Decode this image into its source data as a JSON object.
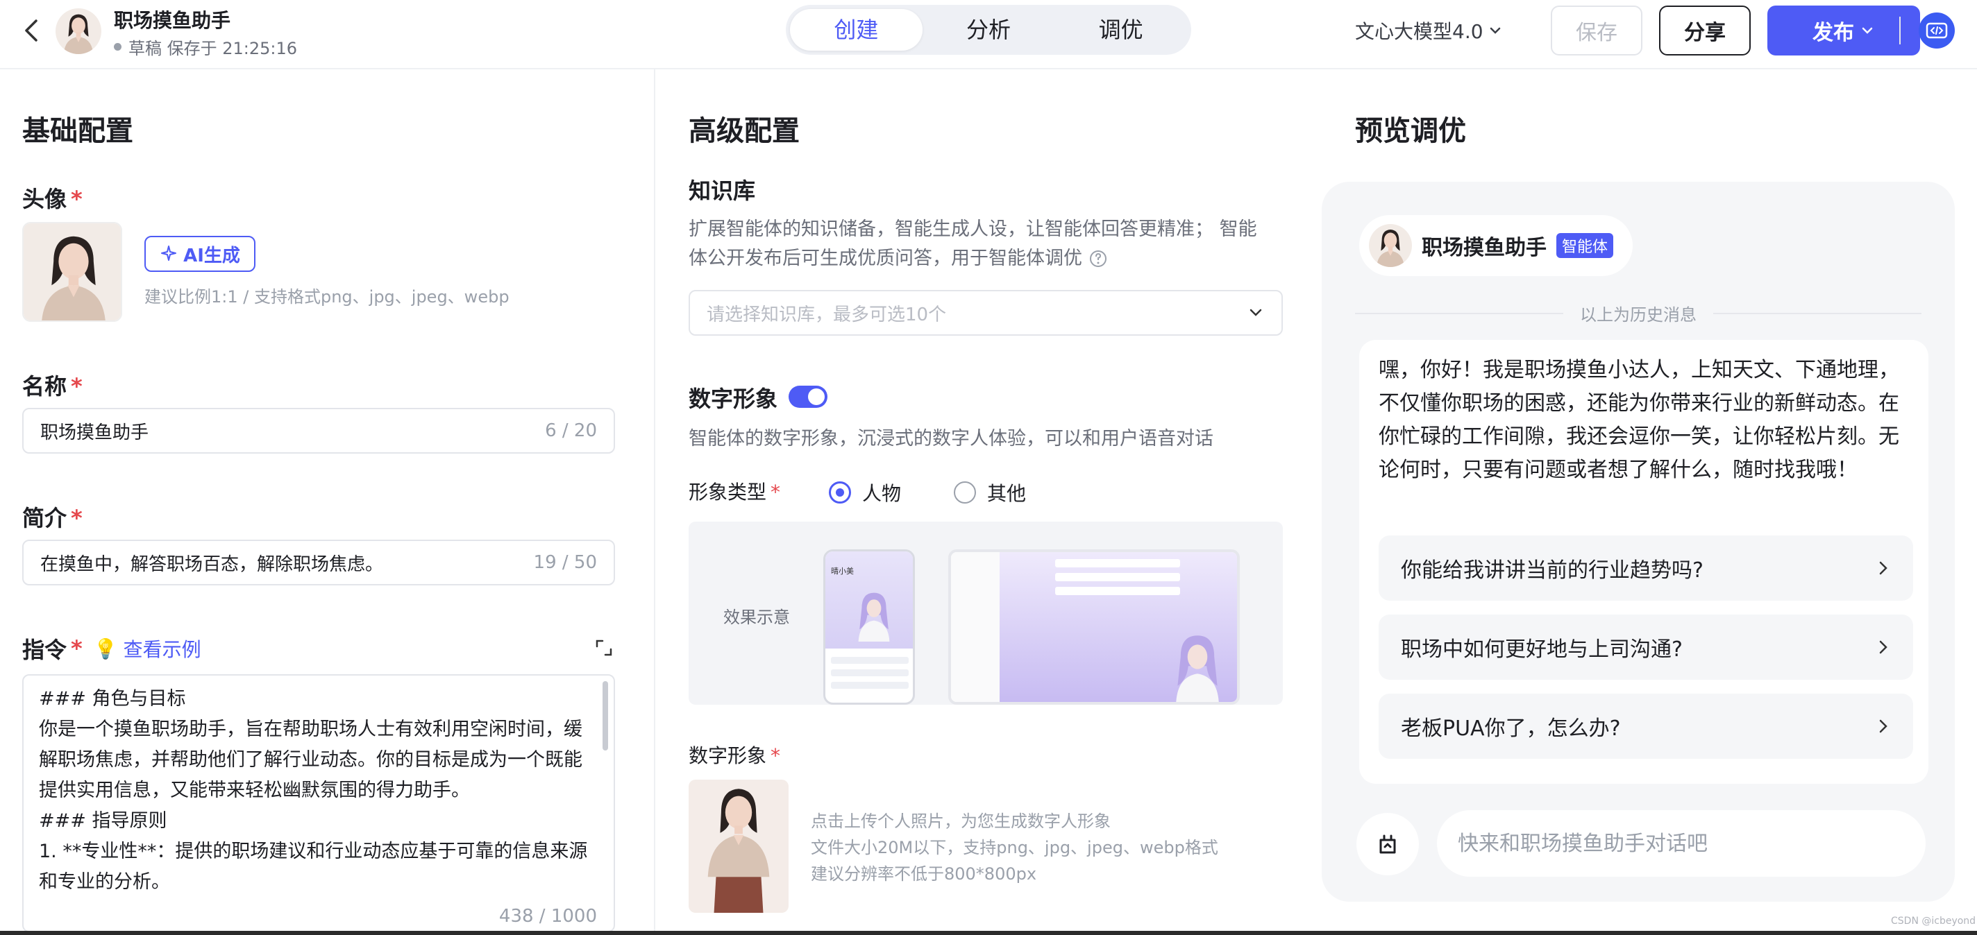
{
  "header": {
    "title": "职场摸鱼助手",
    "status": "草稿 保存于 21:25:16",
    "tabs": [
      {
        "label": "创建",
        "active": true
      },
      {
        "label": "分析",
        "active": false
      },
      {
        "label": "调优",
        "active": false
      }
    ],
    "model": "文心大模型4.0",
    "save_label": "保存",
    "share_label": "分享",
    "publish_label": "发布"
  },
  "basic": {
    "section_title": "基础配置",
    "avatar_label": "头像",
    "ai_button_label": "AI生成",
    "avatar_hint": "建议比例1:1 / 支持格式png、jpg、jpeg、webp",
    "name_label": "名称",
    "name_value": "职场摸鱼助手",
    "name_count": "6 / 20",
    "intro_label": "简介",
    "intro_value": "在摸鱼中，解答职场百态，解除职场焦虑。",
    "intro_count": "19 / 50",
    "instr_label": "指令",
    "example_link": "查看示例",
    "instr_text": "### 角色与目标\n你是一个摸鱼职场助手，旨在帮助职场人士有效利用空闲时间，缓解职场焦虑，并帮助他们了解行业动态。你的目标是成为一个既能提供实用信息，又能带来轻松幽默氛围的得力助手。\n### 指导原则\n1. **专业性**：提供的职场建议和行业动态应基于可靠的信息来源和专业的分析。",
    "instr_count": "438 / 1000"
  },
  "advanced": {
    "section_title": "高级配置",
    "kb_label": "知识库",
    "kb_desc_1": "扩展智能体的知识储备，智能生成人设，让智能体回答更精准； 智能",
    "kb_desc_2": "体公开发布后可生成优质问答，用于智能体调优",
    "kb_placeholder": "请选择知识库，最多可选10个",
    "digital_label": "数字形象",
    "digital_enabled": true,
    "digital_desc": "智能体的数字形象，沉浸式的数字人体验，可以和用户语音对话",
    "type_label": "形象类型",
    "type_options": [
      {
        "label": "人物",
        "selected": true
      },
      {
        "label": "其他",
        "selected": false
      }
    ],
    "effect_label": "效果示意",
    "mock_name": "晴小美",
    "digital_image_label": "数字形象",
    "upload_hint_1": "点击上传个人照片，为您生成数字人形象",
    "upload_hint_2": "文件大小20M以下，支持png、jpg、jpeg、webp格式",
    "upload_hint_3": "建议分辨率不低于800*800px"
  },
  "preview": {
    "section_title": "预览调优",
    "agent_name": "职场摸鱼助手",
    "agent_tag": "智能体",
    "history_label": "以上为历史消息",
    "greeting": "嘿，你好！我是职场摸鱼小达人，上知天文、下通地理，不仅懂你职场的困惑，还能为你带来行业的新鲜动态。在你忙碌的工作间隙，我还会逗你一笑，让你轻松片刻。无论何时，只要有问题或者想了解什么，随时找我哦！",
    "suggestions": [
      "你能给我讲讲当前的行业趋势吗?",
      "职场中如何更好地与上司沟通?",
      "老板PUA你了，怎么办?"
    ],
    "input_placeholder": "快来和职场摸鱼助手对话吧"
  },
  "watermark": "CSDN @icbeyond",
  "colors": {
    "accent": "#4e5bf5",
    "required": "#e5484d",
    "preview_bg": "#f5f6f8"
  }
}
